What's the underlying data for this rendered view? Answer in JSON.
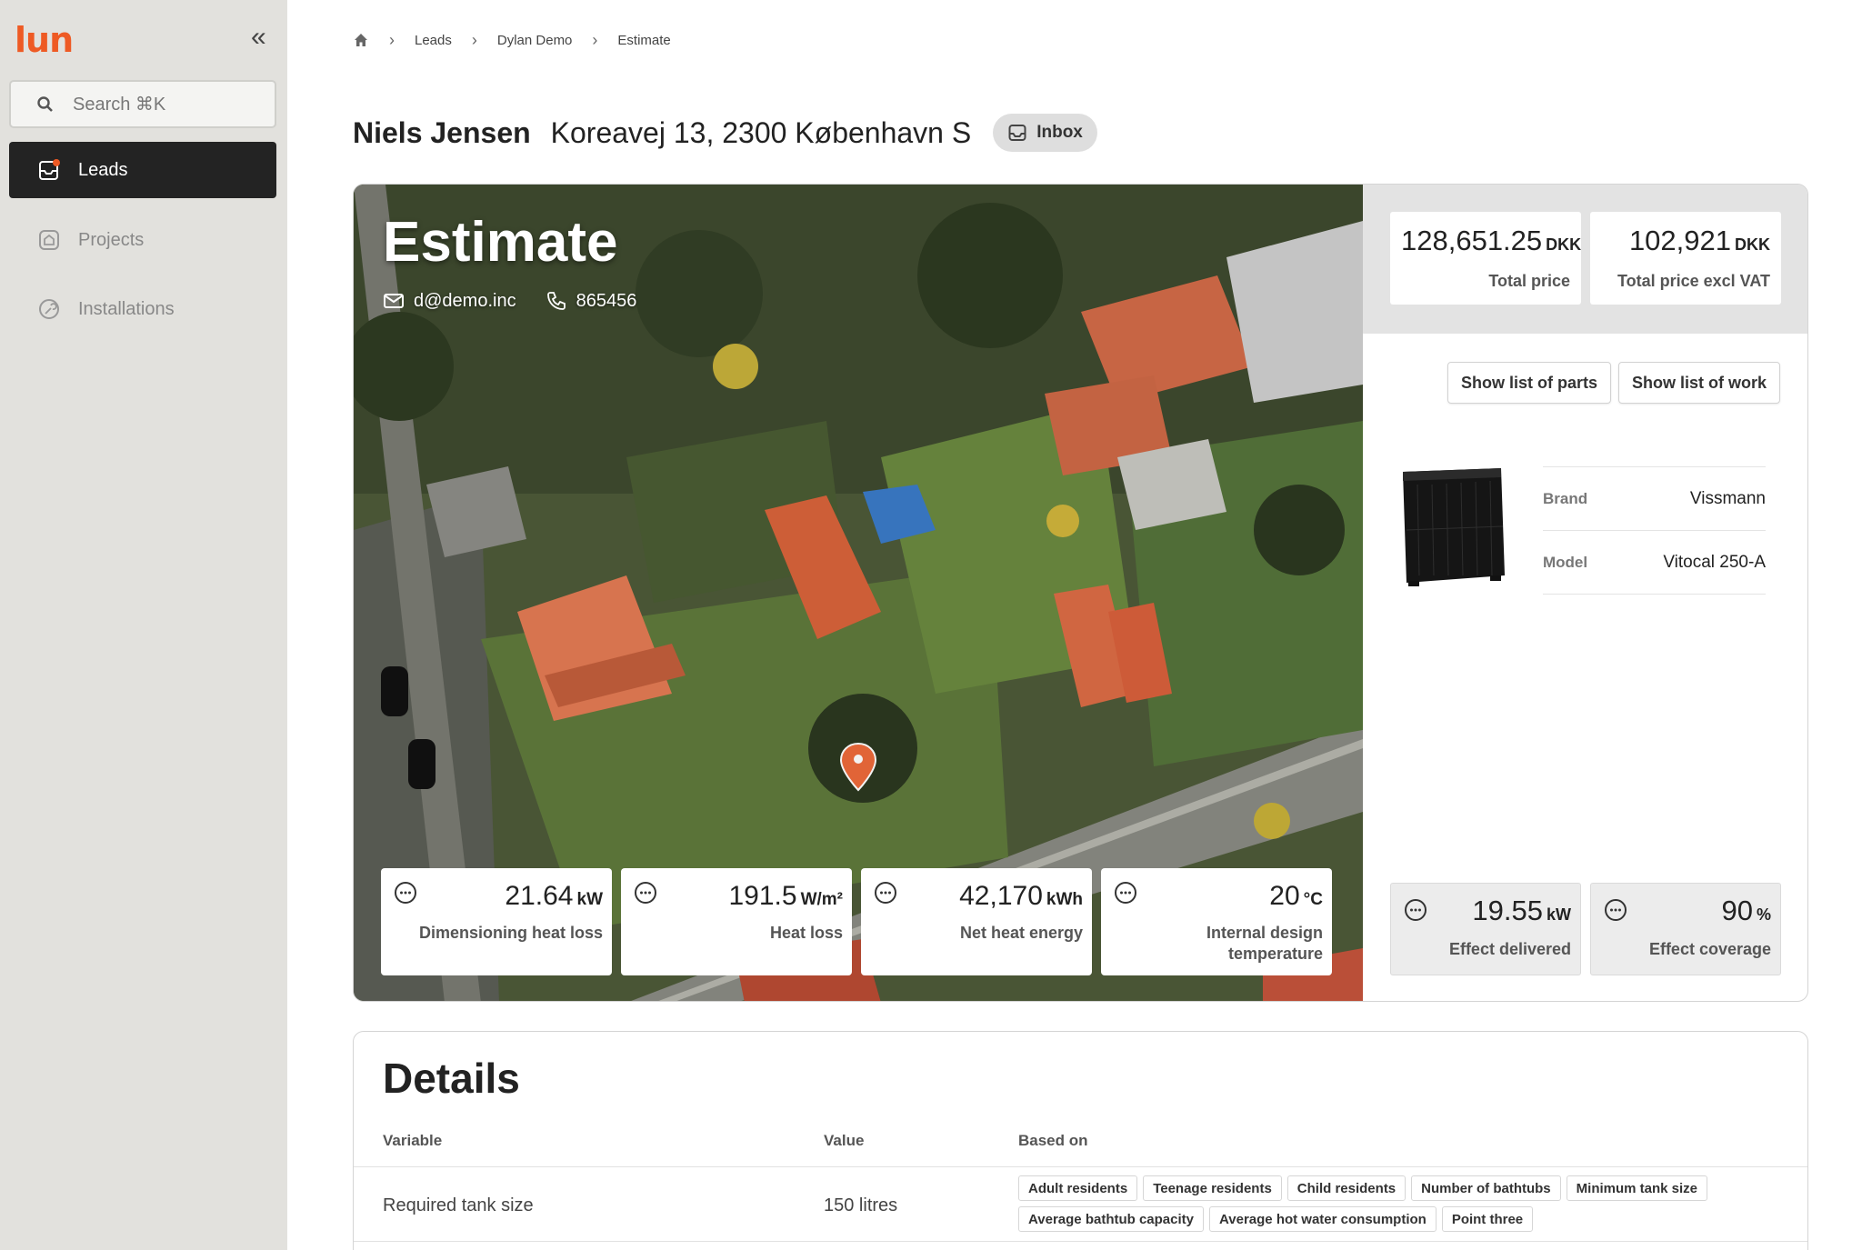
{
  "sidebar": {
    "logo": "lun",
    "search_placeholder": "Search ⌘K",
    "items": [
      {
        "label": "Leads",
        "active": true
      },
      {
        "label": "Projects",
        "active": false
      },
      {
        "label": "Installations",
        "active": false
      }
    ]
  },
  "breadcrumb": [
    "Leads",
    "Dylan Demo",
    "Estimate"
  ],
  "header": {
    "name": "Niels Jensen",
    "address": "Koreavej 13, 2300 København S",
    "inbox_label": "Inbox"
  },
  "estimate": {
    "title": "Estimate",
    "email": "d@demo.inc",
    "phone": "865456",
    "stats": [
      {
        "value": "21.64",
        "unit": "kW",
        "label": "Dimensioning heat loss"
      },
      {
        "value": "191.5",
        "unit": "W/m²",
        "label": "Heat loss"
      },
      {
        "value": "42,170",
        "unit": "kWh",
        "label": "Net heat energy"
      },
      {
        "value": "20",
        "unit": "°C",
        "label": "Internal design temperature"
      }
    ]
  },
  "pricing": {
    "total": {
      "value": "128,651.25",
      "currency": "DKK",
      "label": "Total price"
    },
    "excl_vat": {
      "value": "102,921",
      "currency": "DKK",
      "label": "Total price excl VAT"
    }
  },
  "buttons": {
    "parts": "Show list of parts",
    "work": "Show list of work"
  },
  "product": {
    "brand_label": "Brand",
    "brand": "Vissmann",
    "model_label": "Model",
    "model": "Vitocal 250-A"
  },
  "effects": [
    {
      "value": "19.55",
      "unit": "kW",
      "label": "Effect delivered"
    },
    {
      "value": "90",
      "unit": "%",
      "label": "Effect coverage"
    }
  ],
  "details": {
    "title": "Details",
    "columns": [
      "Variable",
      "Value",
      "Based on"
    ],
    "rows": [
      {
        "variable": "Required tank size",
        "value": "150 litres",
        "based_on": [
          "Adult residents",
          "Teenage residents",
          "Child residents",
          "Number of bathtubs",
          "Minimum tank size",
          "Average bathtub capacity",
          "Average hot water consumption",
          "Point three"
        ]
      }
    ]
  },
  "colors": {
    "brand": "#ee5a24",
    "sidebar_bg": "#e2e1dd",
    "active_nav": "#232323",
    "pin": "#ee6a3a"
  }
}
